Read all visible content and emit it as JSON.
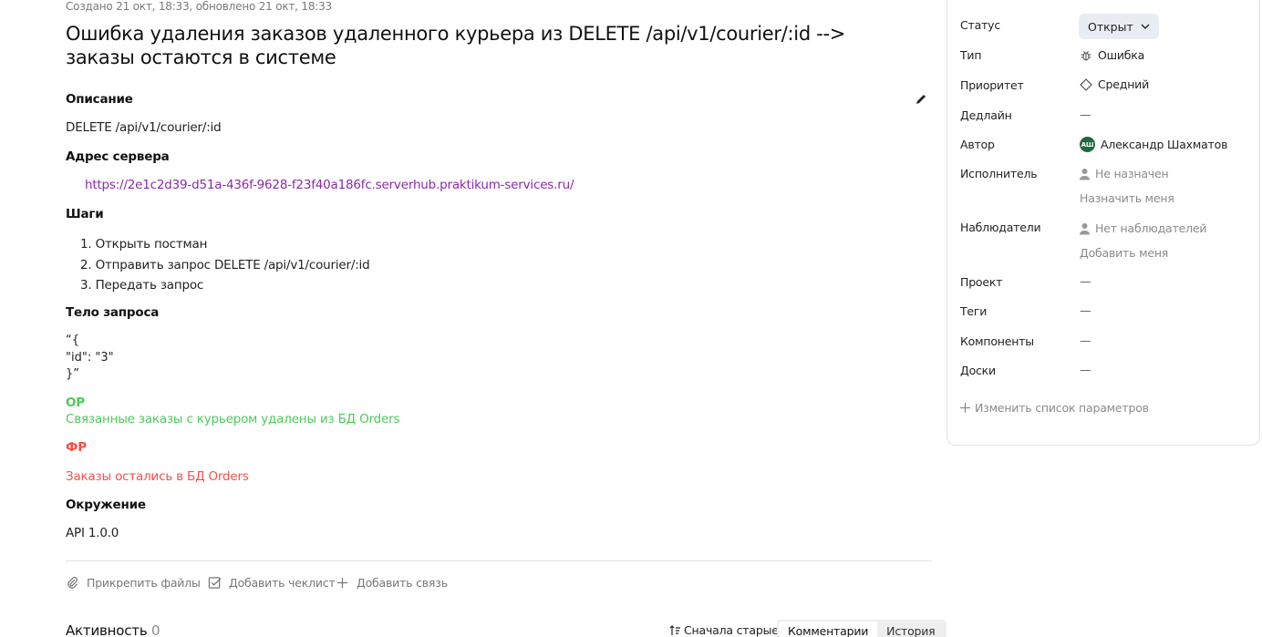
{
  "meta": "Создано 21 окт, 18:33, обновлено 21 окт, 18:33",
  "title": "Ошибка удаления заказов удаленного курьера из DELETE /api/v1/courier/:id --> заказы остаются в системе",
  "description": {
    "heading": "Описание",
    "text": "DELETE /api/v1/courier/:id",
    "server_heading": "Адрес сервера",
    "server_url": "https://2e1c2d39-d51a-436f-9628-f23f40a186fc.serverhub.praktikum-services.ru/",
    "steps_heading": "Шаги",
    "steps": [
      "1. Открыть постман",
      "2. Отправить запрос DELETE /api/v1/courier/:id",
      "3. Передать запрос"
    ],
    "body_heading": "Тело запроса",
    "body_lines": [
      "“{",
      "\"id\": \"3\"",
      "}”"
    ],
    "expected_label": "ОР",
    "expected_text": "Связанные заказы с курьером удалены из БД Orders",
    "actual_label": "ФР",
    "actual_text": "Заказы остались в БД Orders",
    "env_heading": "Окружение",
    "env_text": "API 1.0.0"
  },
  "actions": {
    "attach": "Прикрепить файлы",
    "checklist": "Добавить чеклист",
    "link": "Добавить связь"
  },
  "activity": {
    "label": "Активность",
    "count": "0",
    "sort": "Сначала старые",
    "tabs": [
      "Комментарии",
      "История"
    ]
  },
  "panel": {
    "status_label": "Статус",
    "status_value": "Открыт",
    "type_label": "Тип",
    "type_value": "Ошибка",
    "priority_label": "Приоритет",
    "priority_value": "Средний",
    "deadline_label": "Дедлайн",
    "deadline_value": "—",
    "author_label": "Автор",
    "author_initials": "АШ",
    "author_value": "Александр Шахматов",
    "assignee_label": "Исполнитель",
    "assignee_value": "Не назначен",
    "assign_me": "Назначить меня",
    "watchers_label": "Наблюдатели",
    "watchers_value": "Нет наблюдателей",
    "add_me": "Добавить меня",
    "project_label": "Проект",
    "project_value": "—",
    "tags_label": "Теги",
    "tags_value": "—",
    "components_label": "Компоненты",
    "components_value": "—",
    "boards_label": "Доски",
    "boards_value": "—",
    "change_params": "Изменить список параметров"
  },
  "colors": {
    "link": "#8b29a7",
    "expected": "#4cc95a",
    "actual": "#f0524a",
    "status_bg": "#e8edf4",
    "avatar_bg": "#1d6a3c"
  }
}
